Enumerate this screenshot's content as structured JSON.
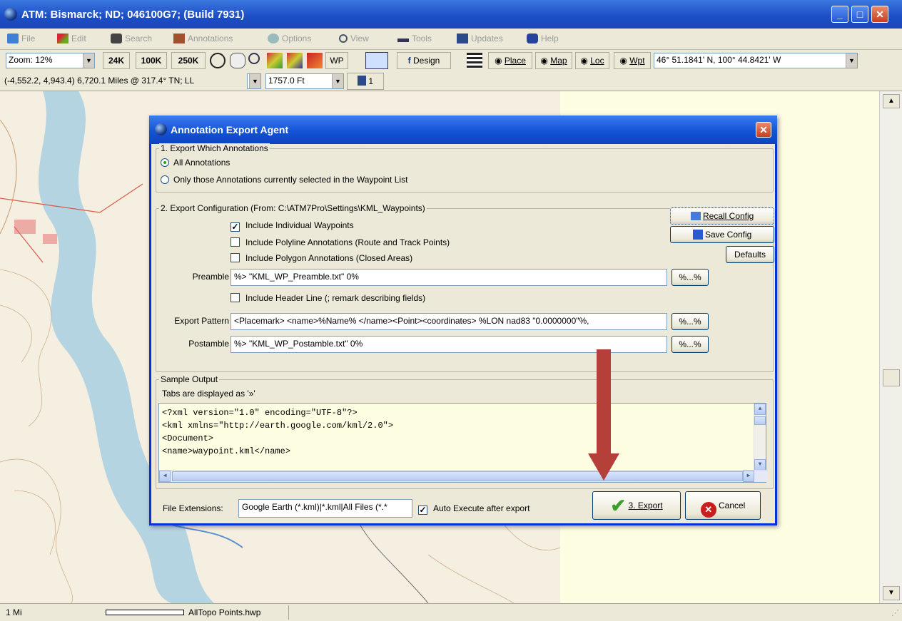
{
  "window": {
    "title": "ATM: Bismarck; ND; 046100G7; (Build 7931)"
  },
  "menu": {
    "items": [
      "File",
      "Edit",
      "Search",
      "Annotations",
      "Options",
      "View",
      "Tools",
      "Updates",
      "Help"
    ]
  },
  "toolbar": {
    "zoom": "Zoom: 12%",
    "scales": [
      "24K",
      "100K",
      "250K"
    ],
    "wp_label": "WP",
    "design_label": "Design",
    "place_label": "Place",
    "map_label": "Map",
    "loc_label": "Loc",
    "wpt_label": "Wpt",
    "coords": "46° 51.1841' N, 100° 44.8421' W",
    "distance": "(-4,552.2, 4,943.4) 6,720.1 Miles @ 317.4° TN; LL",
    "elevation": "1757.0 Ft",
    "layer_count": "1"
  },
  "status": {
    "scale": "1 Mi",
    "file": "AllTopo Points.hwp"
  },
  "dialog": {
    "title": "Annotation Export Agent",
    "section1": {
      "label": "1. Export Which Annotations",
      "opt_all": "All Annotations",
      "opt_selected": "Only those Annotations currently selected in the Waypoint List"
    },
    "section2": {
      "label": "2. Export Configuration  (From: C:\\ATM7Pro\\Settings\\KML_Waypoints)",
      "cb_waypoints": "Include Individual Waypoints",
      "cb_polyline": "Include Polyline Annotations (Route and Track Points)",
      "cb_polygon": "Include Polygon Annotations (Closed Areas)",
      "cb_header": "Include Header Line (; remark describing fields)",
      "preamble_label": "Preamble",
      "preamble_value": "%> \"KML_WP_Preamble.txt\" 0%",
      "pattern_label": "Export Pattern",
      "pattern_value": "<Placemark> <name>%Name% </name><Point><coordinates> %LON nad83 \"0.0000000\"%,",
      "postamble_label": "Postamble",
      "postamble_value": "%> \"KML_WP_Postamble.txt\" 0%",
      "macro_btn": "%...%",
      "recall": "Recall Config",
      "save": "Save Config",
      "defaults": "Defaults"
    },
    "sample": {
      "label": "Sample Output",
      "tabs_note": "Tabs are displayed as '»'",
      "lines": [
        "<?xml version=\"1.0\" encoding=\"UTF-8\"?>",
        "<kml xmlns=\"http://earth.google.com/kml/2.0\">",
        "<Document>",
        "<name>waypoint.kml</name>"
      ]
    },
    "footer": {
      "ext_label": "File Extensions:",
      "ext_value": "Google Earth (*.kml)|*.kml|All Files (*.*",
      "auto_exec": "Auto Execute after export",
      "export": "3. Export",
      "cancel": "Cancel"
    }
  }
}
